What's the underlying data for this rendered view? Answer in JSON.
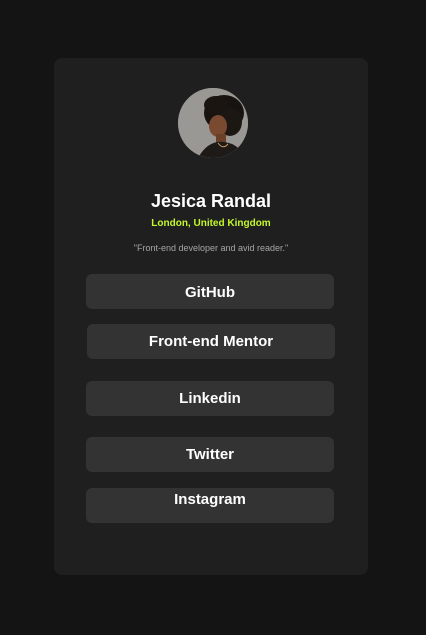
{
  "profile": {
    "name": "Jesica Randal",
    "location": "London, United Kingdom",
    "bio": "\"Front-end developer and avid reader.\"",
    "avatar_alt": "profile photo"
  },
  "links": {
    "github": "GitHub",
    "frontend_mentor": "Front-end Mentor",
    "linkedin": "Linkedin",
    "twitter": "Twitter",
    "instagram": "Instagram"
  },
  "colors": {
    "page_background": "#141414",
    "card_background": "#1f1f1f",
    "button_background": "#333333",
    "accent": "#c4f82a",
    "text_primary": "#ffffff",
    "text_muted": "#a6a6a6"
  }
}
